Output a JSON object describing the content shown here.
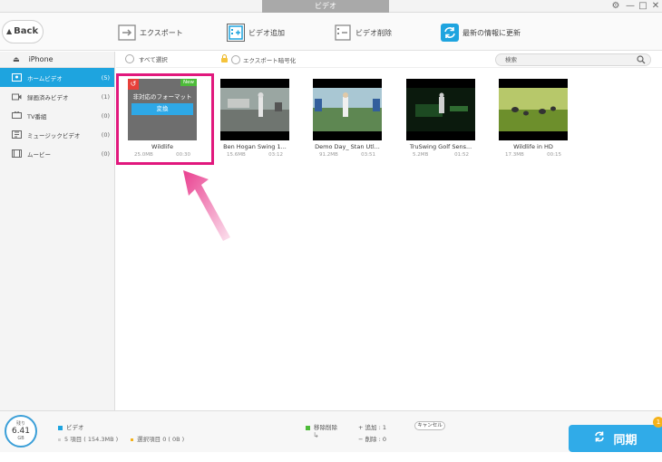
{
  "window": {
    "title": "ビデオ",
    "controls": [
      "⚙",
      "—",
      "□",
      "✕"
    ]
  },
  "toolbar": {
    "back_label": "Back",
    "items": [
      {
        "label": "エクスポート",
        "icon": "export-icon"
      },
      {
        "label": "ビデオ追加",
        "icon": "add-video-icon"
      },
      {
        "label": "ビデオ削除",
        "icon": "delete-video-icon"
      },
      {
        "label": "最新の情報に更新",
        "icon": "refresh-icon"
      }
    ]
  },
  "sidebar": {
    "device": "iPhone",
    "items": [
      {
        "label": "ホームビデオ",
        "count": "(5)",
        "active": true
      },
      {
        "label": "録画済みビデオ",
        "count": "(1)"
      },
      {
        "label": "TV番組",
        "count": "(0)"
      },
      {
        "label": "ミュージックビデオ",
        "count": "(0)"
      },
      {
        "label": "ムービー",
        "count": "(0)"
      }
    ]
  },
  "filter": {
    "select_all": "すべて選択",
    "encrypt": "エクスポート暗号化",
    "search_placeholder": "検索"
  },
  "videos": [
    {
      "name": "Wildlife",
      "size": "25.0MB",
      "duration": "00:30",
      "unsupported_text": "非対応のフォーマット",
      "convert_label": "変換",
      "badge": "New"
    },
    {
      "name": "Ben Hogan Swing 1...",
      "size": "15.6MB",
      "duration": "03:12"
    },
    {
      "name": "Demo Day_ Stan Utl...",
      "size": "91.2MB",
      "duration": "03:51"
    },
    {
      "name": "TruSwing Golf Sens...",
      "size": "5.2MB",
      "duration": "01:52"
    },
    {
      "name": "Wildlife in HD",
      "size": "17.3MB",
      "duration": "00:15"
    }
  ],
  "bottom": {
    "storage_label": "残り",
    "storage_value": "6.41",
    "storage_unit": "GB",
    "category": "ビデオ",
    "items_summary": "5 項目 ( 154.3MB )",
    "selected_summary": "選択項目 0 ( 0B )",
    "pending_delete": "移除削除",
    "add_count": "追加 : 1",
    "delete_count": "削除 : 0",
    "cancel_label": "キャンセル",
    "sync_label": "同期",
    "sync_badge": "1",
    "colors": {
      "accent": "#1ea4df",
      "pending": "#4dbb39",
      "selected": "#f5b21a",
      "highlight": "#e1187d"
    }
  }
}
